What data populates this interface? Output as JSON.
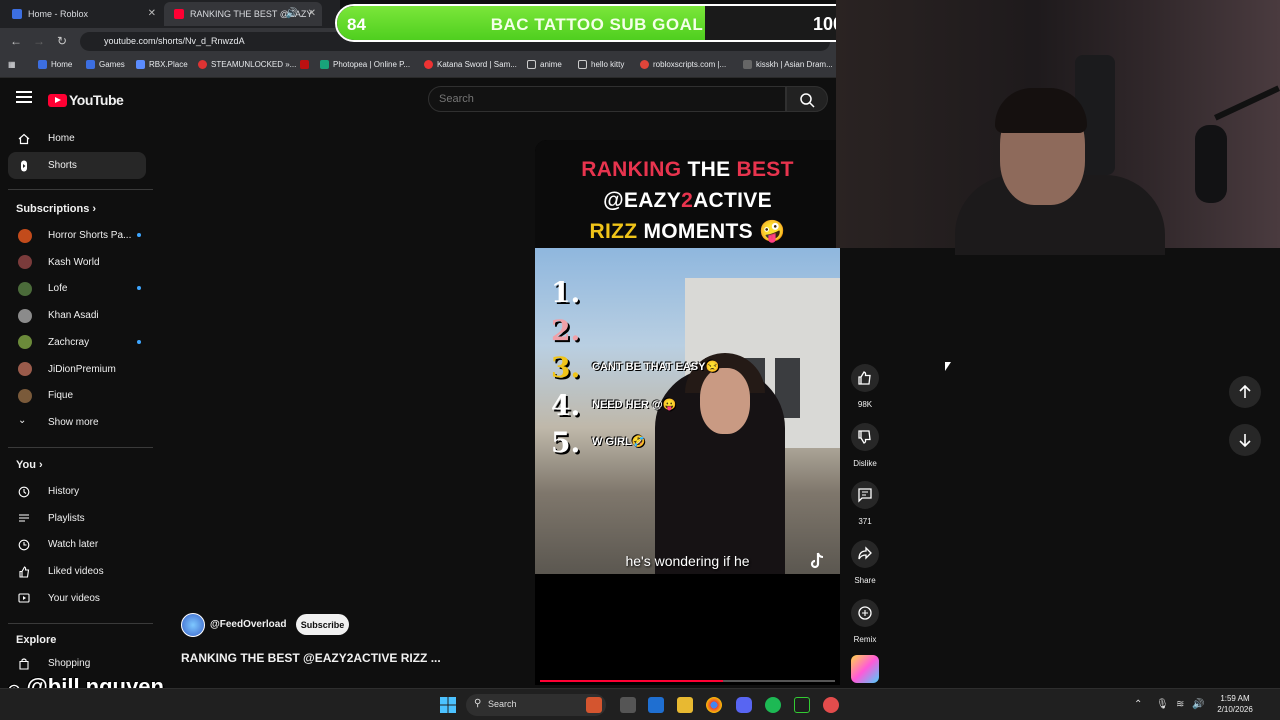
{
  "browser": {
    "tabs": [
      {
        "label": "Home - Roblox",
        "active": false
      },
      {
        "label": "RANKING THE BEST @EAZY",
        "active": true
      }
    ],
    "url": "youtube.com/shorts/Nv_d_RnwzdA",
    "bookmarks": [
      "Home",
      "Games",
      "RBX.Place",
      "STEAMUNLOCKED »...",
      "Photopea | Online P...",
      "Katana Sword | Sam...",
      "anime",
      "hello kitty",
      "robloxscripts.com |...",
      "kisskh | Asian Dram..."
    ]
  },
  "goal": {
    "title": "BAC TATTOO SUB GOAL",
    "start": "84",
    "end": "100",
    "progress": 0.84,
    "fill_color": "#7be63a"
  },
  "youtube": {
    "logo": "YouTube",
    "search_placeholder": "Search",
    "accent": "#ff0033"
  },
  "sidebar": {
    "main": [
      {
        "label": "Home",
        "icon": "home-icon",
        "active": false
      },
      {
        "label": "Shorts",
        "icon": "shorts-icon",
        "active": true
      }
    ],
    "subscriptions_title": "Subscriptions",
    "subscriptions": [
      {
        "label": "Horror Shorts Pa...",
        "color": "#c24b1b",
        "new": true
      },
      {
        "label": "Kash World",
        "color": "#7a3b3b",
        "new": false
      },
      {
        "label": "Lofe",
        "color": "#4b6b3a",
        "new": true
      },
      {
        "label": "Khan Asadi",
        "color": "#8b8b8b",
        "new": false
      },
      {
        "label": "Zachcray",
        "color": "#6b8a3a",
        "new": true
      },
      {
        "label": "JiDionPremium",
        "color": "#9a5b4b",
        "new": false
      },
      {
        "label": "Fique",
        "color": "#7a5a3a",
        "new": false
      }
    ],
    "show_more": "Show more",
    "you_title": "You",
    "you": [
      {
        "label": "History",
        "icon": "history-icon"
      },
      {
        "label": "Playlists",
        "icon": "playlists-icon"
      },
      {
        "label": "Watch later",
        "icon": "watch-later-icon"
      },
      {
        "label": "Liked videos",
        "icon": "liked-icon"
      },
      {
        "label": "Your videos",
        "icon": "your-videos-icon"
      }
    ],
    "explore_title": "Explore",
    "explore": [
      {
        "label": "Shopping",
        "icon": "shopping-icon"
      }
    ]
  },
  "short": {
    "title_line1_a": "RANKING",
    "title_line1_b": "THE",
    "title_line1_c": "BEST",
    "title_line2_a": "@EAZY",
    "title_line2_b": "2",
    "title_line2_c": "ACTIVE",
    "title_line3_a": "RIZZ",
    "title_line3_b": "MOMENTS",
    "title_emoji": "🤪",
    "ranks": [
      "1.",
      "2.",
      "3.",
      "4.",
      "5."
    ],
    "captions": [
      {
        "text": "CANT BE THAT EASY😒"
      },
      {
        "text": "NEED HER @😛"
      },
      {
        "text": "W GIRL🤣"
      }
    ],
    "subtitle": "he's wondering if he",
    "progress": 0.62,
    "channel": "@FeedOverload",
    "subscribe": "Subscribe",
    "video_title": "RANKING THE BEST @EAZY2ACTIVE RIZZ ..."
  },
  "actions": [
    {
      "icon": "like-icon",
      "label": "98K"
    },
    {
      "icon": "dislike-icon",
      "label": "Dislike"
    },
    {
      "icon": "comment-icon",
      "label": "371"
    },
    {
      "icon": "share-icon",
      "label": "Share"
    },
    {
      "icon": "remix-icon",
      "label": "Remix"
    }
  ],
  "watermark": "@bill.nguyen",
  "taskbar": {
    "search": "Search",
    "time": "1:59 AM",
    "date": "2/10/2026"
  }
}
